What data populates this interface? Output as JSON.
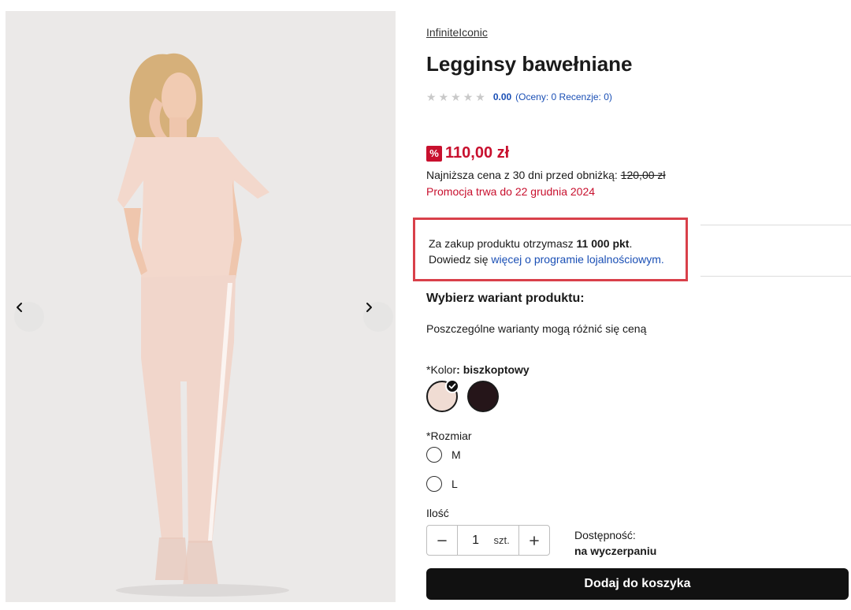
{
  "product": {
    "brand": "InfiniteIconic",
    "title": "Legginsy bawełniane",
    "rating_score": "0.00",
    "rating_meta": "(Oceny: 0 Recenzje: 0)",
    "discount_symbol": "%",
    "price": "110,00 zł",
    "lowest_price_label": "Najniższa cena z 30 dni przed obniżką:",
    "lowest_price_value": "120,00 zł",
    "promo_text": "Promocja trwa do 22 grudnia 2024"
  },
  "loyalty": {
    "text_before": "Za zakup produktu otrzymasz ",
    "points": "11 000 pkt",
    "text_after": ".",
    "line2_before": "Dowiedz się ",
    "link_text": "więcej o programie lojalnościowym."
  },
  "variant": {
    "heading": "Wybierz wariant produktu:",
    "note": "Poszczególne warianty mogą różnić się ceną",
    "color_label": "*Kolor",
    "color_value": "biszkoptowy",
    "swatch_colors": [
      "#f0dcd3",
      "#251519"
    ],
    "size_label": "*Rozmiar",
    "sizes": [
      "M",
      "L"
    ]
  },
  "quantity": {
    "label": "Ilość",
    "value": "1",
    "unit": "szt."
  },
  "availability": {
    "label": "Dostępność:",
    "value": "na wyczerpaniu"
  },
  "cart": {
    "button_label": "Dodaj do koszyka"
  },
  "icons": {
    "prev": "chevron-left-icon",
    "next": "chevron-right-icon",
    "check": "check-icon",
    "star": "star-icon",
    "minus": "minus-icon",
    "plus": "plus-icon"
  }
}
